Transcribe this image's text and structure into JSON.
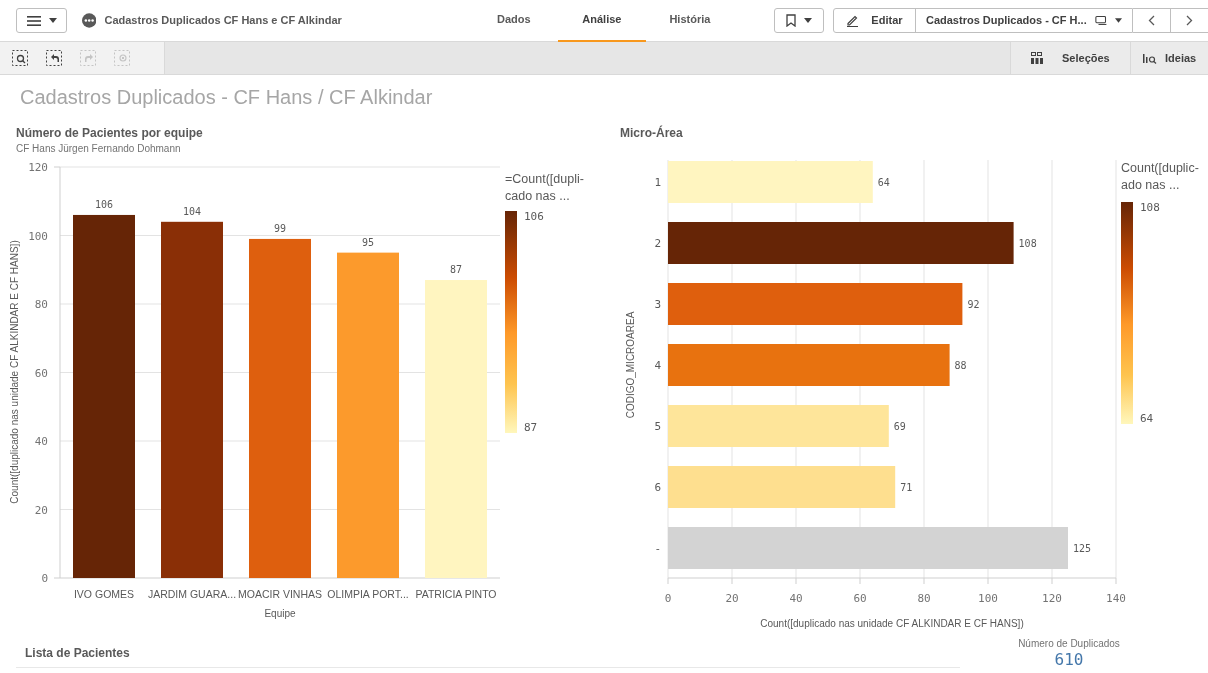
{
  "header": {
    "app_title": "Cadastros Duplicados CF Hans e CF Alkindar",
    "tabs": [
      {
        "label": "Dados",
        "selected": false
      },
      {
        "label": "Análise",
        "selected": true
      },
      {
        "label": "História",
        "selected": false
      }
    ],
    "edit_button": {
      "label": "Editar"
    },
    "sheet_selector": {
      "label": "Cadastros Duplicados - CF H..."
    }
  },
  "toolbar": {
    "tools": [
      {
        "kind": "search",
        "disabled": false
      },
      {
        "kind": "back",
        "disabled": false
      },
      {
        "kind": "forward",
        "disabled": true
      },
      {
        "kind": "clear",
        "disabled": true
      }
    ],
    "right_buttons": [
      {
        "kind": "selections",
        "label": "Seleções"
      },
      {
        "kind": "insights",
        "label": "Ideias"
      }
    ]
  },
  "sheet_title": "Cadastros Duplicados - CF Hans / CF Alkindar",
  "left_chart": {
    "title": "Número de Pacientes por equipe",
    "subtitle": "CF Hans Jürgen Fernando Dohmann",
    "legend": {
      "title_lines": [
        "=Count([dupli-",
        "cado nas ..."
      ],
      "max_label": "106",
      "min_label": "87"
    },
    "chart_data": {
      "type": "bar",
      "orientation": "vertical",
      "xlabel": "Equipe",
      "ylabel": "Count([duplicado nas unidade CF ALKINDAR E CF HANS])",
      "categories": [
        "IVO GOMES",
        "JARDIM GUARA...",
        "MOACIR VINHAS",
        "OLIMPIA PORT...",
        "PATRICIA PINTO"
      ],
      "grid": true,
      "series": [
        {
          "values": [
            106,
            104,
            99,
            95,
            87
          ],
          "colors": [
            "#662506",
            "#8a2f06",
            "#de5f0e",
            "#fc9a2c",
            "#fff5c0"
          ]
        }
      ],
      "ylim": [
        0,
        120
      ],
      "yticks": [
        0,
        20,
        40,
        60,
        80,
        100,
        120
      ],
      "data_labels": true
    }
  },
  "right_chart": {
    "title": "Micro-Área",
    "legend": {
      "title_lines": [
        "Count([duplic-",
        "ado nas ..."
      ],
      "max_label": "108",
      "min_label": "64"
    },
    "chart_data": {
      "type": "bar",
      "orientation": "horizontal",
      "xlabel": "Count([duplicado nas unidade CF ALKINDAR E CF HANS])",
      "ylabel": "CODIGO_MICROAREA",
      "categories": [
        "1",
        "2",
        "3",
        "4",
        "5",
        "6",
        "-"
      ],
      "grid": true,
      "series": [
        {
          "values": [
            64,
            108,
            92,
            88,
            69,
            71,
            125
          ],
          "colors": [
            "#fff5c0",
            "#662506",
            "#df5f0d",
            "#e8720f",
            "#fee59a",
            "#fedf8f",
            "#d3d3d3"
          ]
        }
      ],
      "xlim": [
        0,
        140
      ],
      "xticks": [
        0,
        20,
        40,
        60,
        80,
        100,
        120,
        140
      ],
      "data_labels": true
    }
  },
  "table": {
    "title": "Lista de Pacientes"
  },
  "kpi": {
    "label": "Número de Duplicados",
    "value": "610"
  }
}
